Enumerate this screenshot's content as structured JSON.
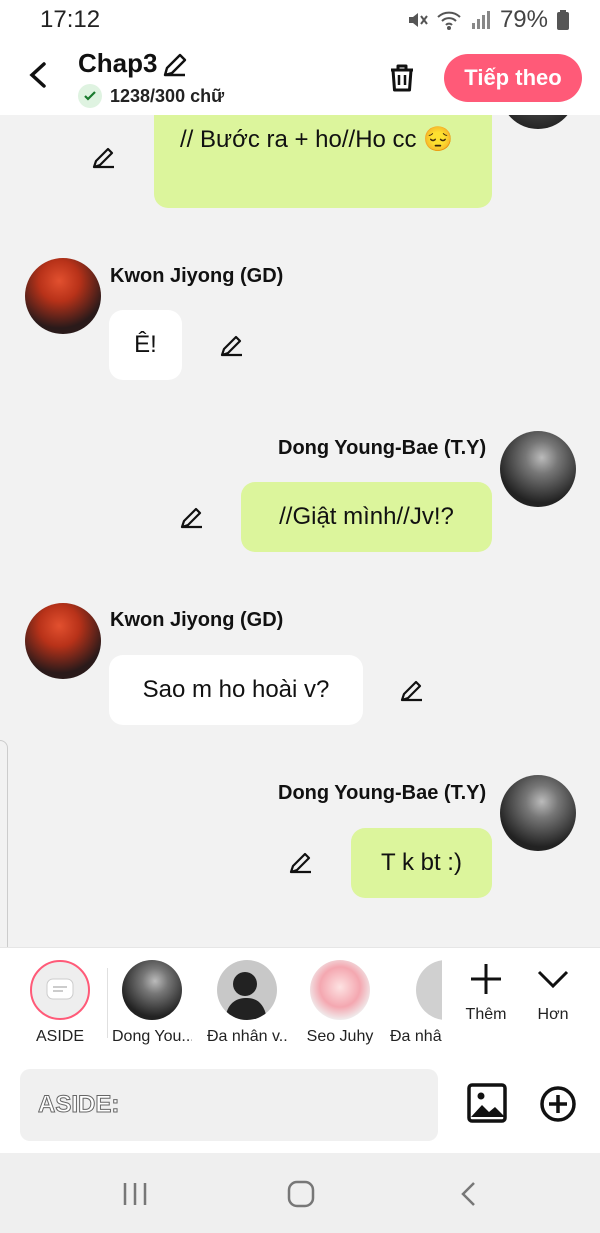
{
  "status_bar": {
    "time": "17:12",
    "battery": "79%"
  },
  "header": {
    "title": "Chap3",
    "word_count": "1238/300 chữ",
    "next_label": "Tiếp theo"
  },
  "messages": [
    {
      "side": "right",
      "text": "// Bước ra + ho//Ho cc 😔"
    },
    {
      "side": "left",
      "name": "Kwon Jiyong (GD)",
      "text": "Ê!"
    },
    {
      "side": "right",
      "name": "Dong Young-Bae (T.Y)",
      "text": "//Giật mình//Jv!?"
    },
    {
      "side": "left",
      "name": "Kwon Jiyong (GD)",
      "text": "Sao m ho hoài v?"
    },
    {
      "side": "right",
      "name": "Dong Young-Bae (T.Y)",
      "text": "T k bt :)"
    }
  ],
  "characters": [
    {
      "label": "ASIDE",
      "icon": "message-box-icon"
    },
    {
      "label": "Dong You..."
    },
    {
      "label": "Đa nhân v..."
    },
    {
      "label": "Seo Juhy"
    },
    {
      "label": "Đa nhâ"
    }
  ],
  "tools": {
    "add_label": "Thêm",
    "more_label": "Hơn"
  },
  "composer": {
    "placeholder": "ASIDE:"
  },
  "colors": {
    "accent": "#ff5a78",
    "bubble_green": "#dcf59c",
    "bubble_white": "#ffffff",
    "background": "#f2f2f2"
  }
}
